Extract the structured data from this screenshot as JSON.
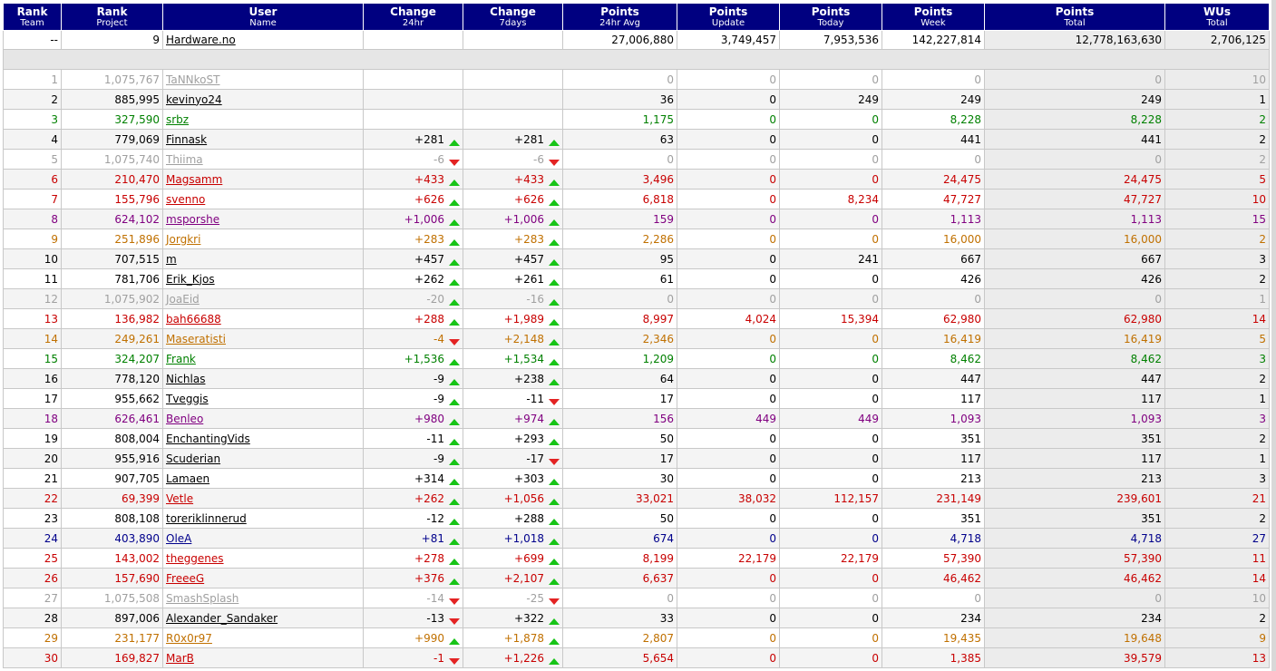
{
  "headers": [
    {
      "title": "Rank",
      "sub": "Team"
    },
    {
      "title": "Rank",
      "sub": "Project"
    },
    {
      "title": "User",
      "sub": "Name"
    },
    {
      "title": "Change",
      "sub": "24hr"
    },
    {
      "title": "Change",
      "sub": "7days"
    },
    {
      "title": "Points",
      "sub": "24hr Avg"
    },
    {
      "title": "Points",
      "sub": "Update"
    },
    {
      "title": "Points",
      "sub": "Today"
    },
    {
      "title": "Points",
      "sub": "Week"
    },
    {
      "title": "Points",
      "sub": "Total"
    },
    {
      "title": "WUs",
      "sub": "Total"
    }
  ],
  "team": {
    "rank_team": "--",
    "rank_project": "9",
    "name": "Hardware.no",
    "change24": "",
    "change7": "",
    "avg": "27,006,880",
    "update": "3,749,457",
    "today": "7,953,536",
    "week": "142,227,814",
    "total": "12,778,163,630",
    "wus": "2,706,125"
  },
  "colors": {
    "black": "#000000",
    "gray": "#a0a0a0",
    "green": "#008000",
    "red": "#c80000",
    "purple": "#800080",
    "orange": "#c07000",
    "blue": "#00008b",
    "header_bg": "#000080",
    "arrow_up": "#17c417",
    "arrow_down": "#e32323"
  },
  "rows": [
    {
      "rank": "1",
      "proj": "1,075,767",
      "name": "TaNNkoST",
      "c24": "",
      "d24": "",
      "c7": "",
      "d7": "",
      "avg": "0",
      "upd": "0",
      "today": "0",
      "week": "0",
      "total": "0",
      "wus": "10",
      "color": "gray"
    },
    {
      "rank": "2",
      "proj": "885,995",
      "name": "kevinyo24",
      "c24": "",
      "d24": "",
      "c7": "",
      "d7": "",
      "avg": "36",
      "upd": "0",
      "today": "249",
      "week": "249",
      "total": "249",
      "wus": "1",
      "color": "black"
    },
    {
      "rank": "3",
      "proj": "327,590",
      "name": "srbz",
      "c24": "",
      "d24": "",
      "c7": "",
      "d7": "",
      "avg": "1,175",
      "upd": "0",
      "today": "0",
      "week": "8,228",
      "total": "8,228",
      "wus": "2",
      "color": "green"
    },
    {
      "rank": "4",
      "proj": "779,069",
      "name": "Finnask",
      "c24": "+281",
      "d24": "up",
      "c7": "+281",
      "d7": "up",
      "avg": "63",
      "upd": "0",
      "today": "0",
      "week": "441",
      "total": "441",
      "wus": "2",
      "color": "black"
    },
    {
      "rank": "5",
      "proj": "1,075,740",
      "name": "Thiima",
      "c24": "-6",
      "d24": "down",
      "c7": "-6",
      "d7": "down",
      "avg": "0",
      "upd": "0",
      "today": "0",
      "week": "0",
      "total": "0",
      "wus": "2",
      "color": "gray"
    },
    {
      "rank": "6",
      "proj": "210,470",
      "name": "Magsamm",
      "c24": "+433",
      "d24": "up",
      "c7": "+433",
      "d7": "up",
      "avg": "3,496",
      "upd": "0",
      "today": "0",
      "week": "24,475",
      "total": "24,475",
      "wus": "5",
      "color": "red"
    },
    {
      "rank": "7",
      "proj": "155,796",
      "name": "svenno",
      "c24": "+626",
      "d24": "up",
      "c7": "+626",
      "d7": "up",
      "avg": "6,818",
      "upd": "0",
      "today": "8,234",
      "week": "47,727",
      "total": "47,727",
      "wus": "10",
      "color": "red"
    },
    {
      "rank": "8",
      "proj": "624,102",
      "name": "msporshe",
      "c24": "+1,006",
      "d24": "up",
      "c7": "+1,006",
      "d7": "up",
      "avg": "159",
      "upd": "0",
      "today": "0",
      "week": "1,113",
      "total": "1,113",
      "wus": "15",
      "color": "purple"
    },
    {
      "rank": "9",
      "proj": "251,896",
      "name": "Jorgkri",
      "c24": "+283",
      "d24": "up",
      "c7": "+283",
      "d7": "up",
      "avg": "2,286",
      "upd": "0",
      "today": "0",
      "week": "16,000",
      "total": "16,000",
      "wus": "2",
      "color": "orange"
    },
    {
      "rank": "10",
      "proj": "707,515",
      "name": "m",
      "c24": "+457",
      "d24": "up",
      "c7": "+457",
      "d7": "up",
      "avg": "95",
      "upd": "0",
      "today": "241",
      "week": "667",
      "total": "667",
      "wus": "3",
      "color": "black"
    },
    {
      "rank": "11",
      "proj": "781,706",
      "name": "Erik_Kjos",
      "c24": "+262",
      "d24": "up",
      "c7": "+261",
      "d7": "up",
      "avg": "61",
      "upd": "0",
      "today": "0",
      "week": "426",
      "total": "426",
      "wus": "2",
      "color": "black"
    },
    {
      "rank": "12",
      "proj": "1,075,902",
      "name": "JoaEid",
      "c24": "-20",
      "d24": "up",
      "c7": "-16",
      "d7": "up",
      "avg": "0",
      "upd": "0",
      "today": "0",
      "week": "0",
      "total": "0",
      "wus": "1",
      "color": "gray"
    },
    {
      "rank": "13",
      "proj": "136,982",
      "name": "bah66688",
      "c24": "+288",
      "d24": "up",
      "c7": "+1,989",
      "d7": "up",
      "avg": "8,997",
      "upd": "4,024",
      "today": "15,394",
      "week": "62,980",
      "total": "62,980",
      "wus": "14",
      "color": "red"
    },
    {
      "rank": "14",
      "proj": "249,261",
      "name": "Maseratisti",
      "c24": "-4",
      "d24": "down",
      "c7": "+2,148",
      "d7": "up",
      "avg": "2,346",
      "upd": "0",
      "today": "0",
      "week": "16,419",
      "total": "16,419",
      "wus": "5",
      "color": "orange"
    },
    {
      "rank": "15",
      "proj": "324,207",
      "name": "Frank",
      "c24": "+1,536",
      "d24": "up",
      "c7": "+1,534",
      "d7": "up",
      "avg": "1,209",
      "upd": "0",
      "today": "0",
      "week": "8,462",
      "total": "8,462",
      "wus": "3",
      "color": "green"
    },
    {
      "rank": "16",
      "proj": "778,120",
      "name": "Nichlas",
      "c24": "-9",
      "d24": "up",
      "c7": "+238",
      "d7": "up",
      "avg": "64",
      "upd": "0",
      "today": "0",
      "week": "447",
      "total": "447",
      "wus": "2",
      "color": "black"
    },
    {
      "rank": "17",
      "proj": "955,662",
      "name": "Tveggis",
      "c24": "-9",
      "d24": "up",
      "c7": "-11",
      "d7": "down",
      "avg": "17",
      "upd": "0",
      "today": "0",
      "week": "117",
      "total": "117",
      "wus": "1",
      "color": "black"
    },
    {
      "rank": "18",
      "proj": "626,461",
      "name": "Benleo",
      "c24": "+980",
      "d24": "up",
      "c7": "+974",
      "d7": "up",
      "avg": "156",
      "upd": "449",
      "today": "449",
      "week": "1,093",
      "total": "1,093",
      "wus": "3",
      "color": "purple"
    },
    {
      "rank": "19",
      "proj": "808,004",
      "name": "EnchantingVids",
      "c24": "-11",
      "d24": "up",
      "c7": "+293",
      "d7": "up",
      "avg": "50",
      "upd": "0",
      "today": "0",
      "week": "351",
      "total": "351",
      "wus": "2",
      "color": "black"
    },
    {
      "rank": "20",
      "proj": "955,916",
      "name": "Scuderian",
      "c24": "-9",
      "d24": "up",
      "c7": "-17",
      "d7": "down",
      "avg": "17",
      "upd": "0",
      "today": "0",
      "week": "117",
      "total": "117",
      "wus": "1",
      "color": "black"
    },
    {
      "rank": "21",
      "proj": "907,705",
      "name": "Lamaen",
      "c24": "+314",
      "d24": "up",
      "c7": "+303",
      "d7": "up",
      "avg": "30",
      "upd": "0",
      "today": "0",
      "week": "213",
      "total": "213",
      "wus": "3",
      "color": "black"
    },
    {
      "rank": "22",
      "proj": "69,399",
      "name": "Vetle",
      "c24": "+262",
      "d24": "up",
      "c7": "+1,056",
      "d7": "up",
      "avg": "33,021",
      "upd": "38,032",
      "today": "112,157",
      "week": "231,149",
      "total": "239,601",
      "wus": "21",
      "color": "red"
    },
    {
      "rank": "23",
      "proj": "808,108",
      "name": "toreriklinnerud",
      "c24": "-12",
      "d24": "up",
      "c7": "+288",
      "d7": "up",
      "avg": "50",
      "upd": "0",
      "today": "0",
      "week": "351",
      "total": "351",
      "wus": "2",
      "color": "black"
    },
    {
      "rank": "24",
      "proj": "403,890",
      "name": "OleA",
      "c24": "+81",
      "d24": "up",
      "c7": "+1,018",
      "d7": "up",
      "avg": "674",
      "upd": "0",
      "today": "0",
      "week": "4,718",
      "total": "4,718",
      "wus": "27",
      "color": "blue"
    },
    {
      "rank": "25",
      "proj": "143,002",
      "name": "theggenes",
      "c24": "+278",
      "d24": "up",
      "c7": "+699",
      "d7": "up",
      "avg": "8,199",
      "upd": "22,179",
      "today": "22,179",
      "week": "57,390",
      "total": "57,390",
      "wus": "11",
      "color": "red"
    },
    {
      "rank": "26",
      "proj": "157,690",
      "name": "FreeeG",
      "c24": "+376",
      "d24": "up",
      "c7": "+2,107",
      "d7": "up",
      "avg": "6,637",
      "upd": "0",
      "today": "0",
      "week": "46,462",
      "total": "46,462",
      "wus": "14",
      "color": "red"
    },
    {
      "rank": "27",
      "proj": "1,075,508",
      "name": "SmashSplash",
      "c24": "-14",
      "d24": "down",
      "c7": "-25",
      "d7": "down",
      "avg": "0",
      "upd": "0",
      "today": "0",
      "week": "0",
      "total": "0",
      "wus": "10",
      "color": "gray"
    },
    {
      "rank": "28",
      "proj": "897,006",
      "name": "Alexander_Sandaker",
      "c24": "-13",
      "d24": "down",
      "c7": "+322",
      "d7": "up",
      "avg": "33",
      "upd": "0",
      "today": "0",
      "week": "234",
      "total": "234",
      "wus": "2",
      "color": "black"
    },
    {
      "rank": "29",
      "proj": "231,177",
      "name": "R0x0r97",
      "c24": "+990",
      "d24": "up",
      "c7": "+1,878",
      "d7": "up",
      "avg": "2,807",
      "upd": "0",
      "today": "0",
      "week": "19,435",
      "total": "19,648",
      "wus": "9",
      "color": "orange"
    },
    {
      "rank": "30",
      "proj": "169,827",
      "name": "MarB",
      "c24": "-1",
      "d24": "down",
      "c7": "+1,226",
      "d7": "up",
      "avg": "5,654",
      "upd": "0",
      "today": "0",
      "week": "1,385",
      "total": "39,579",
      "wus": "13",
      "color": "red"
    }
  ]
}
